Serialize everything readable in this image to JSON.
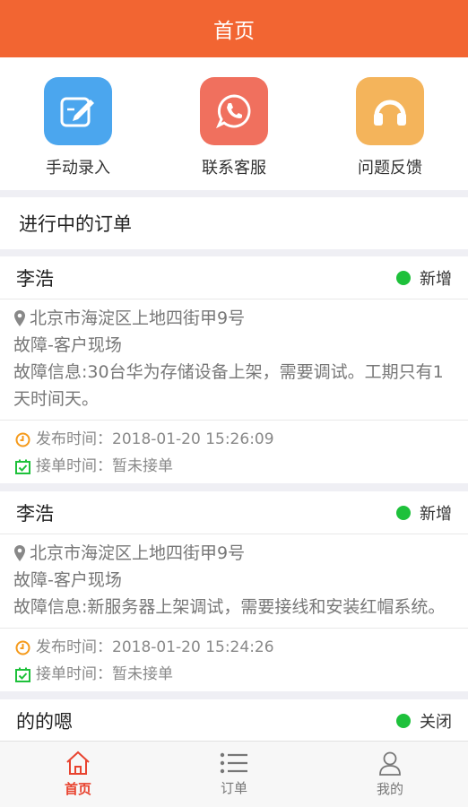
{
  "header": {
    "title": "首页"
  },
  "quick_actions": [
    {
      "label": "手动录入",
      "icon": "edit-icon",
      "color": "#4ba6ee"
    },
    {
      "label": "联系客服",
      "icon": "whatsapp-icon",
      "color": "#f0705e"
    },
    {
      "label": "问题反馈",
      "icon": "headphones-icon",
      "color": "#f4b45b"
    }
  ],
  "section_title": "进行中的订单",
  "orders": [
    {
      "name": "李浩",
      "status": "新增",
      "status_color": "#1ec13b",
      "address": "北京市海淀区上地四街甲9号",
      "type": "故障-客户现场",
      "info": "故障信息:30台华为存储设备上架，需要调试。工期只有1天时间天。",
      "publish_time": "发布时间：2018-01-20 15:26:09",
      "accept_time": "接单时间：暂未接单"
    },
    {
      "name": "李浩",
      "status": "新增",
      "status_color": "#1ec13b",
      "address": "北京市海淀区上地四街甲9号",
      "type": "故障-客户现场",
      "info": "故障信息:新服务器上架调试，需要接线和安装红帽系统。",
      "publish_time": "发布时间：2018-01-20 15:24:26",
      "accept_time": "接单时间：暂未接单"
    },
    {
      "name": "的的嗯",
      "status": "关闭",
      "status_color": "#1ec13b"
    }
  ],
  "tabbar": [
    {
      "label": "首页",
      "icon": "home-icon",
      "active": true
    },
    {
      "label": "订单",
      "icon": "list-icon",
      "active": false
    },
    {
      "label": "我的",
      "icon": "user-icon",
      "active": false
    }
  ],
  "colors": {
    "brand": "#f26532",
    "active_tab": "#e8432f"
  }
}
